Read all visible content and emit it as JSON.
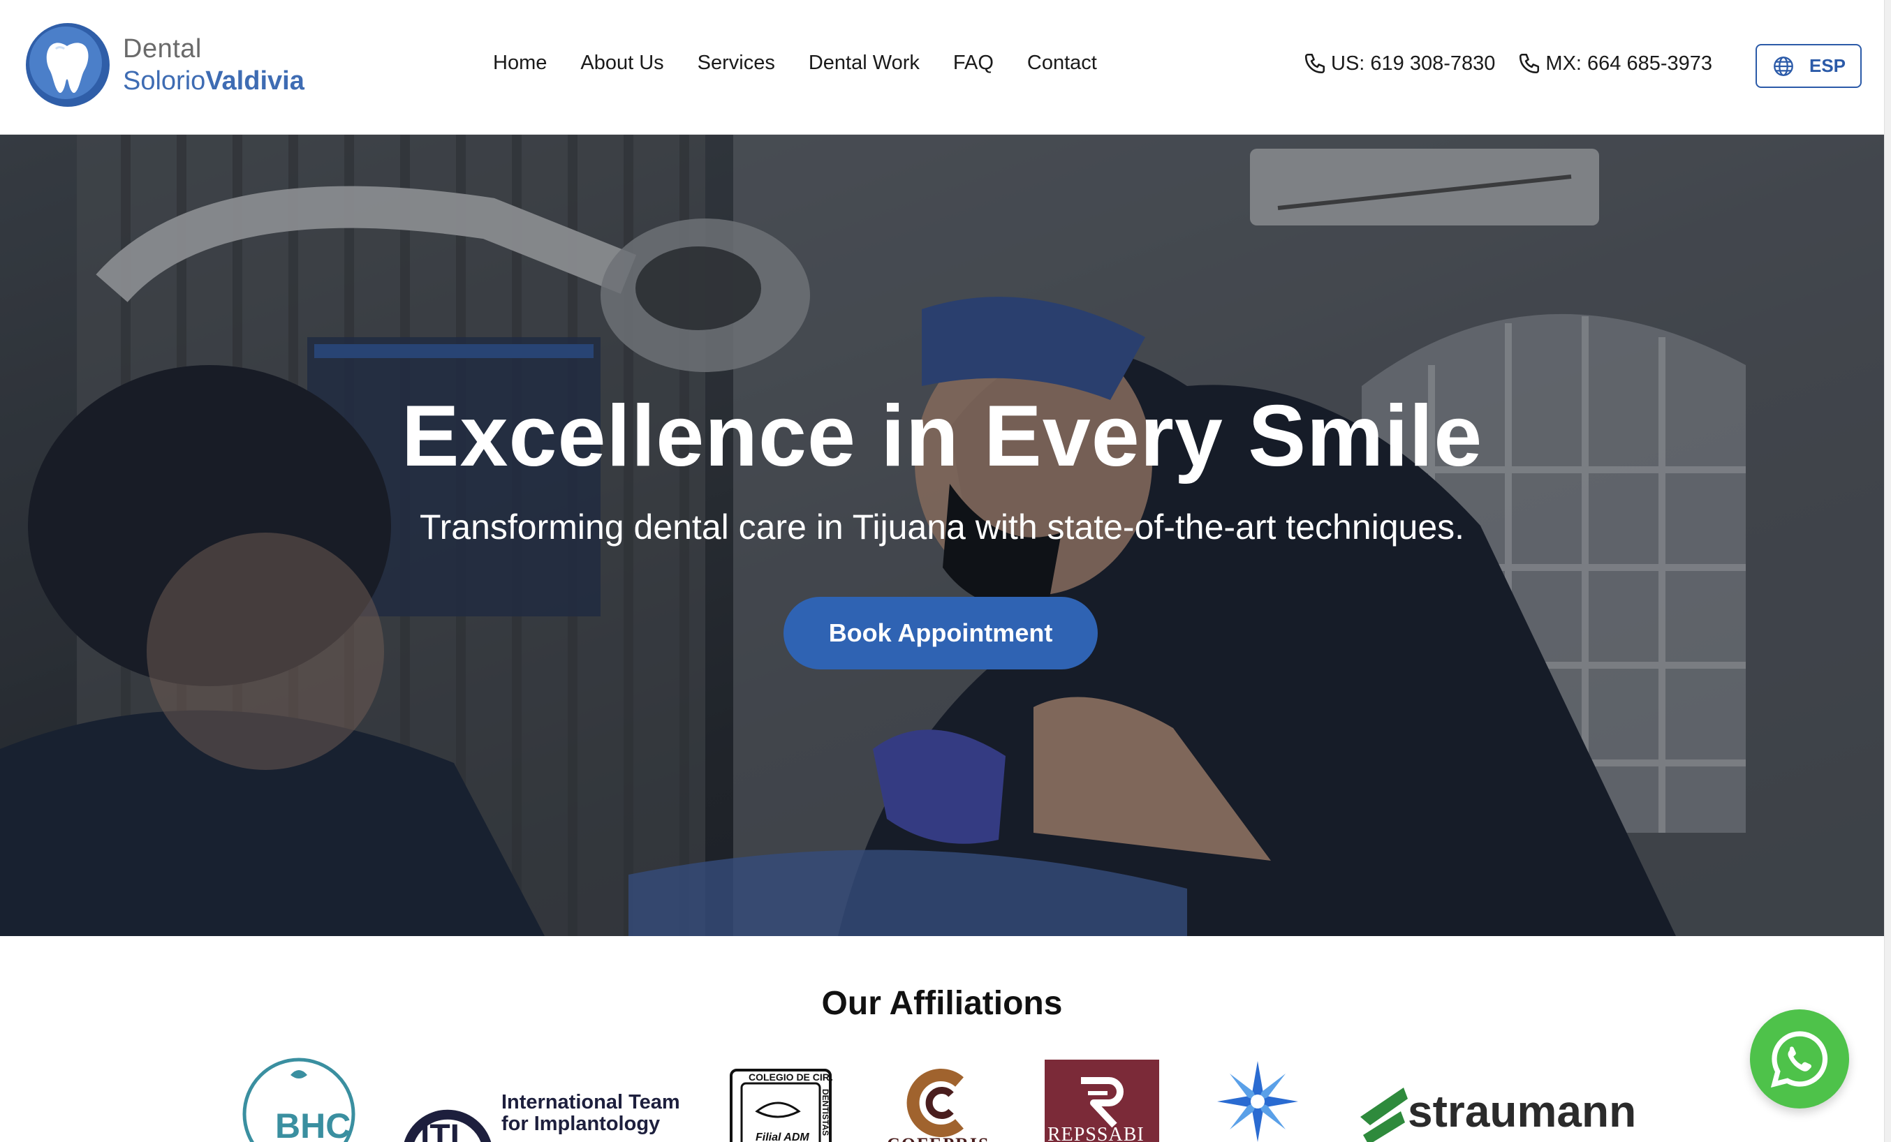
{
  "brand": {
    "line1": "Dental",
    "line2_a": "Solorio",
    "line2_b": "Valdivia",
    "accent": "#3e6cb3"
  },
  "nav": {
    "items": [
      "Home",
      "About Us",
      "Services",
      "Dental Work",
      "FAQ",
      "Contact"
    ]
  },
  "contacts": {
    "us": "US: 619 308-7830",
    "mx": "MX: 664 685-3973",
    "lang": "ESP"
  },
  "hero": {
    "title": "Excellence in Every Smile",
    "subtitle": "Transforming dental care in Tijuana with state-of-the-art techniques.",
    "cta": "Book Appointment",
    "cta_color": "#2f63b3"
  },
  "affiliations": {
    "title": "Our Affiliations",
    "logos": {
      "bhc": "BHC",
      "iti_mark": "ITI",
      "iti_name1": "International Team",
      "iti_name2": "for Implantology",
      "colegio_top": "COLEGIO DE CIRUJANOS",
      "colegio_side": "DENTISTAS",
      "colegio_bottom": "Filial ADM",
      "cofepris": "COFEPRIS",
      "repssabi": "REPSSABI",
      "straumann": "straumann"
    }
  },
  "whatsapp": {
    "icon": "whatsapp-icon",
    "color": "#4ec24a"
  }
}
